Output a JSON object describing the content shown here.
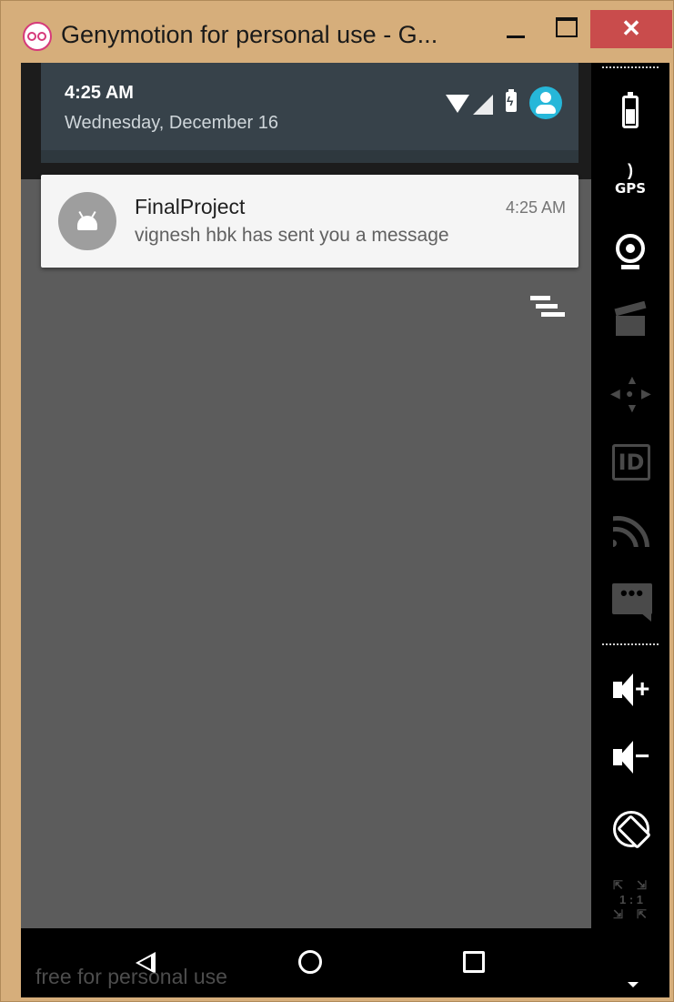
{
  "window": {
    "title": "Genymotion for personal use - G..."
  },
  "status_shade": {
    "time": "4:25 AM",
    "date": "Wednesday, December 16"
  },
  "notification": {
    "app_name": "FinalProject",
    "time": "4:25 AM",
    "message": "vignesh hbk has sent you a message"
  },
  "watermark": "free for personal use",
  "sidebar": {
    "gps_label": "GPS",
    "id_label": "ID",
    "scale_label": "1 : 1"
  },
  "colors": {
    "window_frame": "#d6ae7b",
    "close_button": "#c94c4c",
    "shade_bg": "#37424a",
    "screen_bg": "#5c5c5c",
    "avatar_accent": "#26b7d9",
    "notification_bg": "#f5f5f5"
  },
  "icons": [
    "genymotion-logo-icon",
    "minimize-icon",
    "maximize-icon",
    "close-icon",
    "wifi-icon",
    "signal-icon",
    "battery-charging-icon",
    "user-avatar-icon",
    "android-app-icon",
    "clear-all-icon",
    "back-icon",
    "home-icon",
    "recents-icon",
    "battery-icon",
    "gps-icon",
    "webcam-icon",
    "capture-icon",
    "dpad-icon",
    "device-id-icon",
    "cast-icon",
    "sms-icon",
    "volume-up-icon",
    "volume-down-icon",
    "rotate-icon",
    "scale-icon",
    "chevron-down-icon"
  ]
}
